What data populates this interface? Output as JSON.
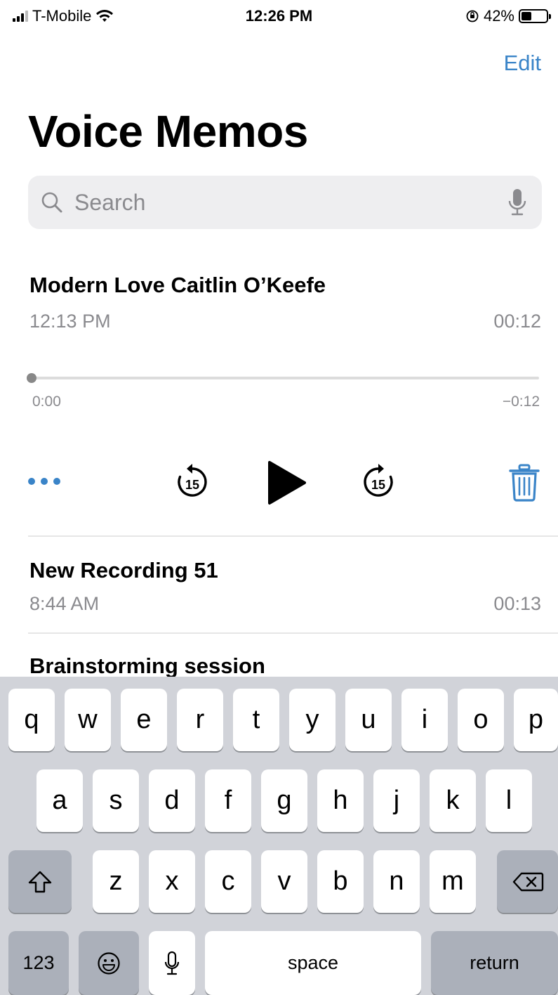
{
  "status_bar": {
    "carrier": "T-Mobile",
    "time": "12:26 PM",
    "battery": "42%",
    "battery_level": 0.42
  },
  "header": {
    "edit_label": "Edit",
    "title": "Voice Memos"
  },
  "search": {
    "placeholder": "Search"
  },
  "recordings": [
    {
      "title": "Modern Love Caitlin O’Keefe",
      "time": "12:13 PM",
      "duration": "00:12"
    },
    {
      "title": "New Recording 51",
      "time": "8:44 AM",
      "duration": "00:13"
    },
    {
      "title": "Brainstorming session"
    }
  ],
  "player": {
    "position_start": "0:00",
    "position_end": "−0:12",
    "progress": 0.0,
    "skip_back_label": "15",
    "skip_forward_label": "15"
  },
  "keyboard": {
    "row1": [
      "q",
      "w",
      "e",
      "r",
      "t",
      "y",
      "u",
      "i",
      "o",
      "p"
    ],
    "row2": [
      "a",
      "s",
      "d",
      "f",
      "g",
      "h",
      "j",
      "k",
      "l"
    ],
    "row3": [
      "z",
      "x",
      "c",
      "v",
      "b",
      "n",
      "m"
    ],
    "numbers_label": "123",
    "space_label": "space",
    "return_label": "return"
  },
  "colors": {
    "accent": "#3a84c8",
    "secondary_text": "#8a8a8e",
    "keyboard_bg": "#d1d3d9"
  }
}
